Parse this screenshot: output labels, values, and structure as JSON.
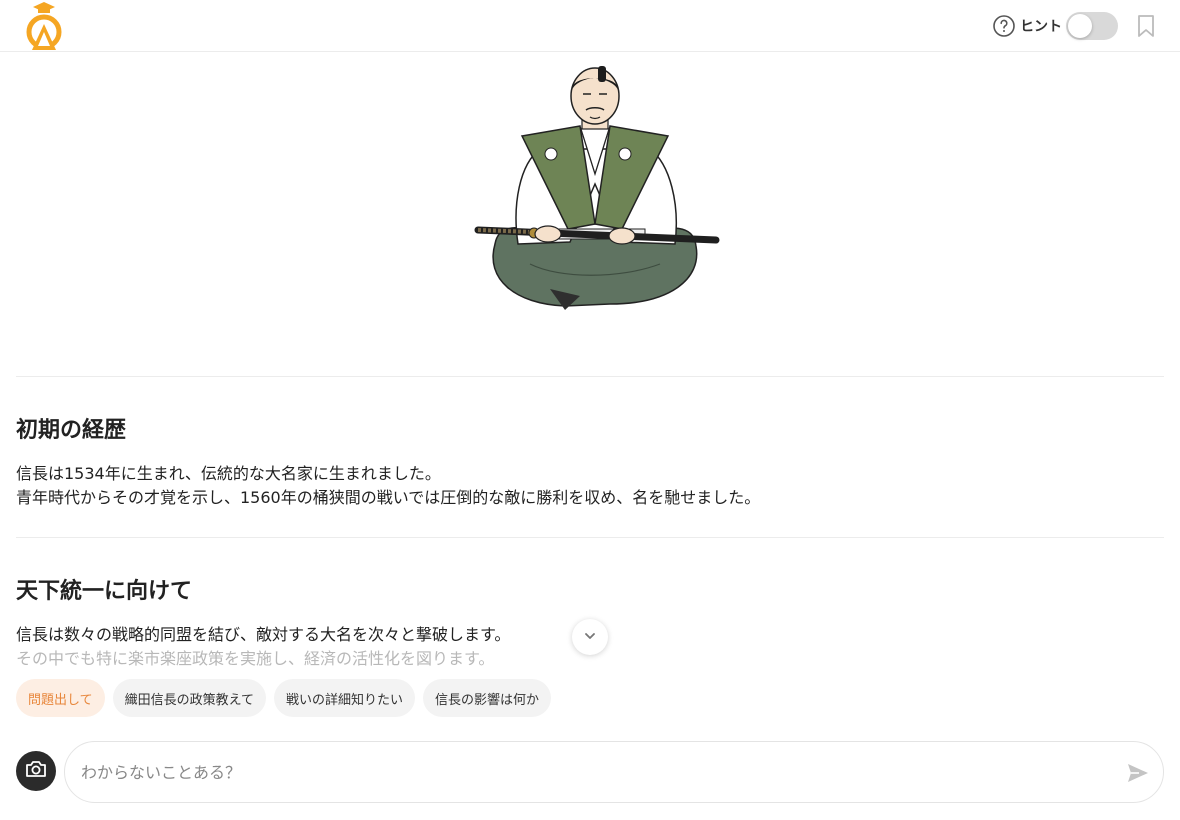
{
  "header": {
    "hint_label": "ヒント",
    "hint_enabled": false,
    "icons": [
      "graduation-cap-logo-icon",
      "help-circle-icon",
      "bookmark-icon"
    ]
  },
  "sections": [
    {
      "title": "初期の経歴",
      "lines": [
        "信長は1534年に生まれ、伝統的な大名家に生まれました。",
        "青年時代からその才覚を示し、1560年の桶狭間の戦いでは圧倒的な敵に勝利を収め、名を馳せました。"
      ]
    },
    {
      "title": "天下統一に向けて",
      "lines": [
        "信長は数々の戦略的同盟を結び、敵対する大名を次々と撃破します。",
        "その中でも特に楽市楽座政策を実施し、経済の活性化を図ります。"
      ]
    }
  ],
  "suggestions": [
    "問題出して",
    "織田信長の政策教えて",
    "戦いの詳細知りたい",
    "信長の影響は何か"
  ],
  "composer": {
    "placeholder": "わからないことある？",
    "value": ""
  },
  "colors": {
    "accent": "#e8873c",
    "accent_bg": "#fdeee3",
    "logo_orange": "#f5a623",
    "hakama_green": "#6e8455"
  }
}
